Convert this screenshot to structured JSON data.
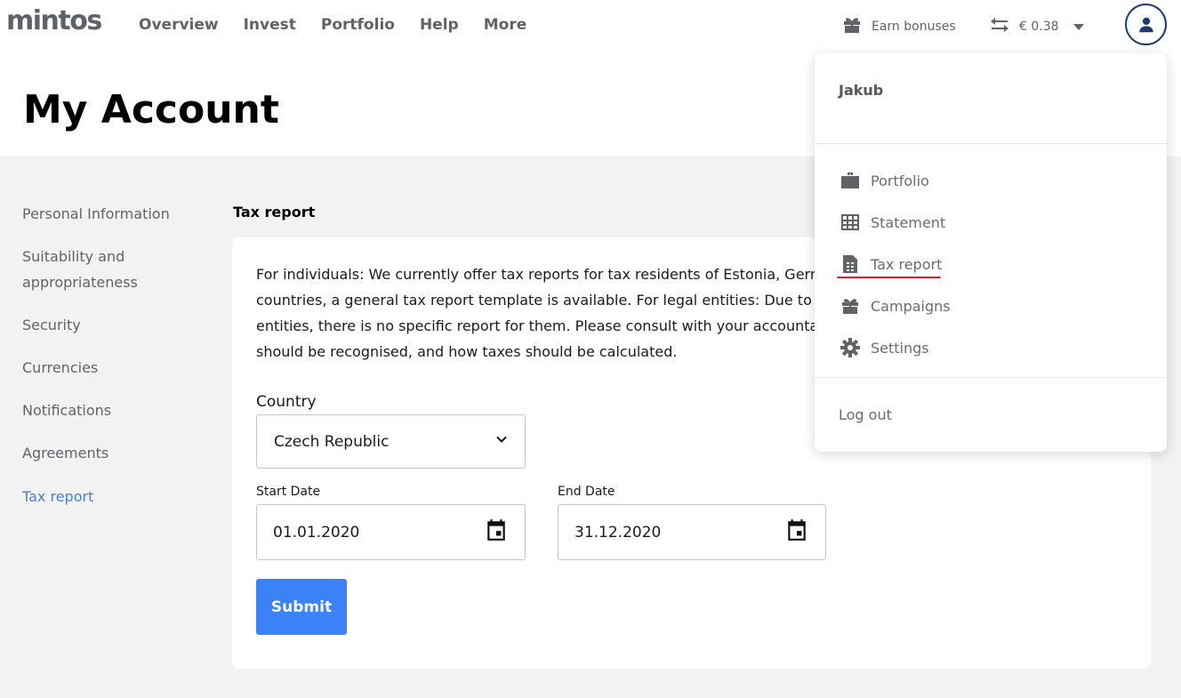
{
  "header": {
    "logo": "mintos",
    "nav": [
      "Overview",
      "Invest",
      "Portfolio",
      "Help",
      "More"
    ],
    "earn_bonuses": "Earn bonuses",
    "balance": "€ 0.38"
  },
  "page": {
    "title": "My Account"
  },
  "sidebar": {
    "items": [
      {
        "label": "Personal Information"
      },
      {
        "label": "Suitability and appropriateness"
      },
      {
        "label": "Security"
      },
      {
        "label": "Currencies"
      },
      {
        "label": "Notifications"
      },
      {
        "label": "Agreements"
      },
      {
        "label": "Tax report",
        "active": true
      }
    ]
  },
  "main": {
    "section_title": "Tax report",
    "description_lines": [
      "For individuals: We currently offer tax reports for tax residents of Estonia, Germa",
      "countries, a general tax report template is available. For legal entities: Due to va",
      "entities, there is no specific report for them. Please consult with your accountan",
      "should be recognised, and how taxes should be calculated."
    ],
    "country_label": "Country",
    "country_value": "Czech Republic",
    "start_date_label": "Start Date",
    "start_date_value": "01.01.2020",
    "end_date_label": "End Date",
    "end_date_value": "31.12.2020",
    "submit_label": "Submit"
  },
  "dropdown": {
    "user": "Jakub",
    "items": [
      {
        "label": "Portfolio",
        "icon": "briefcase-icon"
      },
      {
        "label": "Statement",
        "icon": "table-icon"
      },
      {
        "label": "Tax report",
        "icon": "document-icon",
        "highlighted": true
      },
      {
        "label": "Campaigns",
        "icon": "gift-icon"
      },
      {
        "label": "Settings",
        "icon": "gear-icon"
      }
    ],
    "logout": "Log out"
  },
  "colors": {
    "accent_blue": "#3b82f6",
    "active_link": "#4a7fd6",
    "avatar_border": "#1a3b73",
    "highlight_underline": "#e11d2a"
  }
}
